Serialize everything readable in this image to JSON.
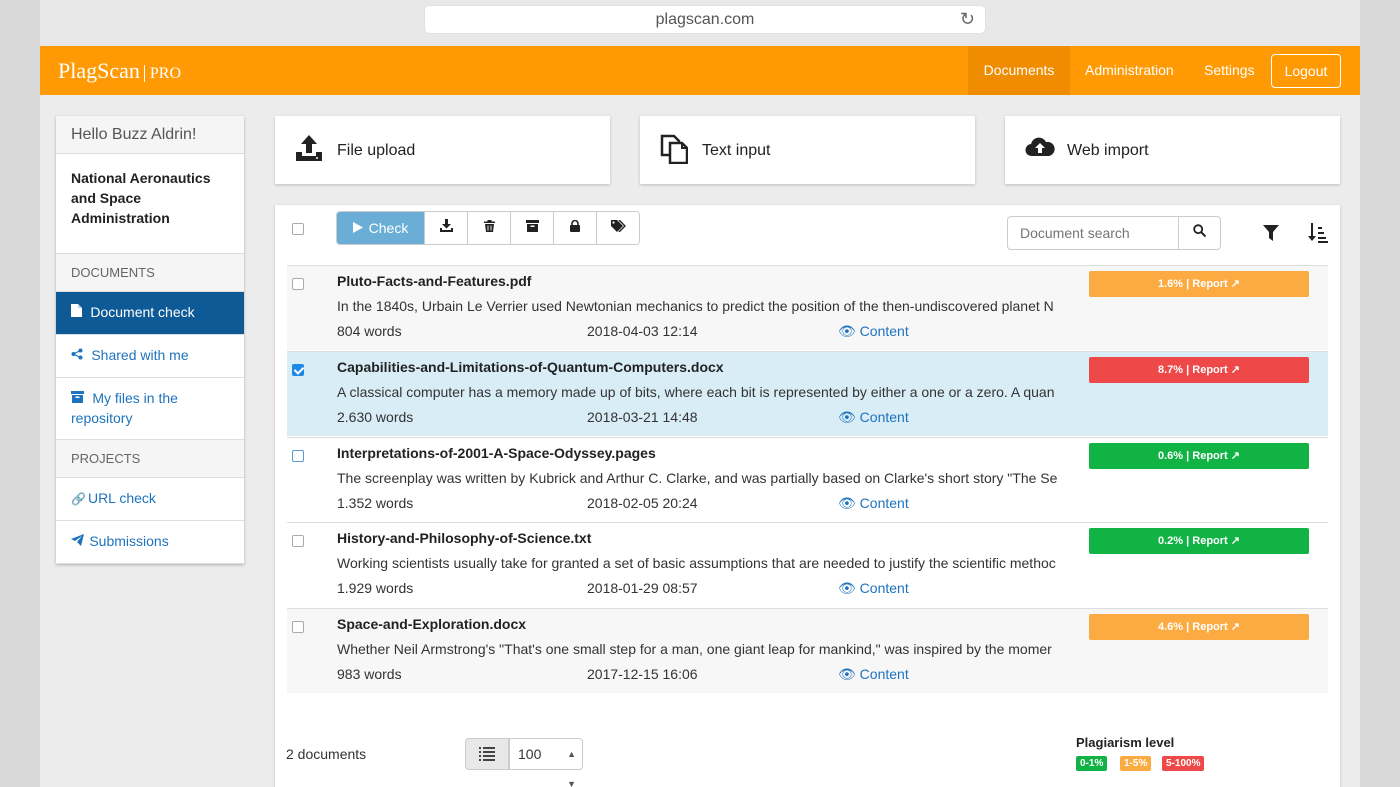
{
  "browser": {
    "url": "plagscan.com"
  },
  "brand": {
    "name": "PlagScan",
    "edition": "PRO"
  },
  "nav": {
    "documents": "Documents",
    "administration": "Administration",
    "settings": "Settings",
    "logout": "Logout"
  },
  "sidebar": {
    "greeting": "Hello Buzz Aldrin!",
    "organization": "National Aeronautics and Space Administration",
    "documents_heading": "DOCUMENTS",
    "items": [
      {
        "label": "Document check",
        "icon": "file-icon",
        "active": true
      },
      {
        "label": "Shared with me",
        "icon": "share-icon",
        "active": false
      },
      {
        "label": "My files in the repository",
        "icon": "archive-icon",
        "active": false
      }
    ],
    "projects_heading": "PROJECTS",
    "project_items": [
      {
        "label": "URL check",
        "icon": "link-icon"
      },
      {
        "label": "Submissions",
        "icon": "paper-plane-icon"
      }
    ]
  },
  "actions": {
    "file_upload": "File upload",
    "text_input": "Text input",
    "web_import": "Web import"
  },
  "toolbar": {
    "check_label": "Check"
  },
  "search": {
    "placeholder": "Document search"
  },
  "documents": [
    {
      "title": "Pluto-Facts-and-Features.pdf",
      "snippet": "In the 1840s, Urbain Le Verrier used Newtonian mechanics to predict the position of the then-undiscovered planet N",
      "words": "804  words",
      "date": "2018-04-03 12:14",
      "content_label": "Content",
      "score": "1.6% | Report",
      "level": "medium",
      "checked": false
    },
    {
      "title": "Capabilities-and-Limitations-of-Quantum-Computers.docx",
      "snippet": "A classical computer has a memory made up of bits, where each bit is represented by either a one or a zero. A quan",
      "words": "2.630  words",
      "date": "2018-03-21 14:48",
      "content_label": "Content",
      "score": "8.7% | Report",
      "level": "high",
      "checked": true
    },
    {
      "title": "Interpretations-of-2001-A-Space-Odyssey.pages",
      "snippet": "The screenplay was written by Kubrick and Arthur C. Clarke, and was partially based on Clarke's short story \"The Se",
      "words": "1.352  words",
      "date": "2018-02-05 20:24",
      "content_label": "Content",
      "score": "0.6% | Report",
      "level": "low",
      "checked": false
    },
    {
      "title": "History-and-Philosophy-of-Science.txt",
      "snippet": "Working scientists usually take for granted a set of basic assumptions that are needed to justify the scientific methoc",
      "words": "1.929  words",
      "date": "2018-01-29 08:57",
      "content_label": "Content",
      "score": "0.2% | Report",
      "level": "low",
      "checked": false
    },
    {
      "title": "Space-and-Exploration.docx",
      "snippet": "Whether Neil Armstrong's \"That's one small step for a man, one giant leap for mankind,\" was inspired by the momer",
      "words": "983  words",
      "date": "2017-12-15 16:06",
      "content_label": "Content",
      "score": "4.6% | Report",
      "level": "medium",
      "checked": false
    }
  ],
  "footer": {
    "count": "2 documents",
    "per_page": "100",
    "legend_title": "Plagiarism level",
    "legend": [
      {
        "label": "0-1%",
        "color": "#12b345"
      },
      {
        "label": "1-5%",
        "color": "#fbab42"
      },
      {
        "label": "5-100%",
        "color": "#ef4848"
      }
    ]
  },
  "colors": {
    "brand": "#ff9a05",
    "low": "#12b345",
    "medium": "#fbab42",
    "high": "#ef4848",
    "link": "#1e73be",
    "active": "#0d5a96"
  }
}
